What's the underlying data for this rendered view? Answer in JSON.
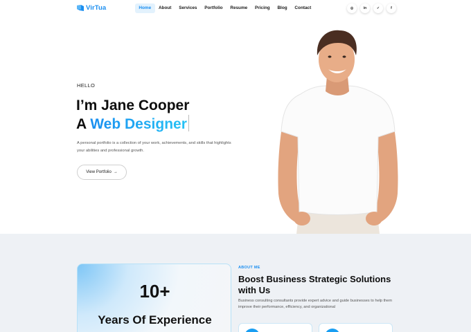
{
  "brand": {
    "name": "VirTua",
    "accent": "#1a8ef0"
  },
  "nav": {
    "items": [
      {
        "label": "Home",
        "active": true
      },
      {
        "label": "About"
      },
      {
        "label": "Services"
      },
      {
        "label": "Portfolio"
      },
      {
        "label": "Resume"
      },
      {
        "label": "Pricing"
      },
      {
        "label": "Blog"
      },
      {
        "label": "Contact"
      }
    ]
  },
  "socials": [
    {
      "icon": "instagram-icon",
      "glyph": "◎"
    },
    {
      "icon": "linkedin-icon",
      "glyph": "in"
    },
    {
      "icon": "twitter-icon",
      "glyph": "✓"
    },
    {
      "icon": "facebook-icon",
      "glyph": "f"
    }
  ],
  "hero": {
    "greeting": "HELLO",
    "title_line1": "I’m Jane Cooper",
    "title_line2_prefix": "A ",
    "title_line2_accent": "Web Designer",
    "description": "A personal portfolio is a collection of your work, achievements, and skills that highlights your abilities and professional growth.",
    "button_label": "View Portfolio",
    "button_arrow": "→"
  },
  "about": {
    "experience_number": "10+",
    "experience_label": "Years Of Experience",
    "tag": "ABOUT ME",
    "title": "Boost Business Strategic Solutions with Us",
    "description": "Business consulting consultants provide expert advice and guide businesses to help them improve their performance, efficiency, and organizational"
  }
}
